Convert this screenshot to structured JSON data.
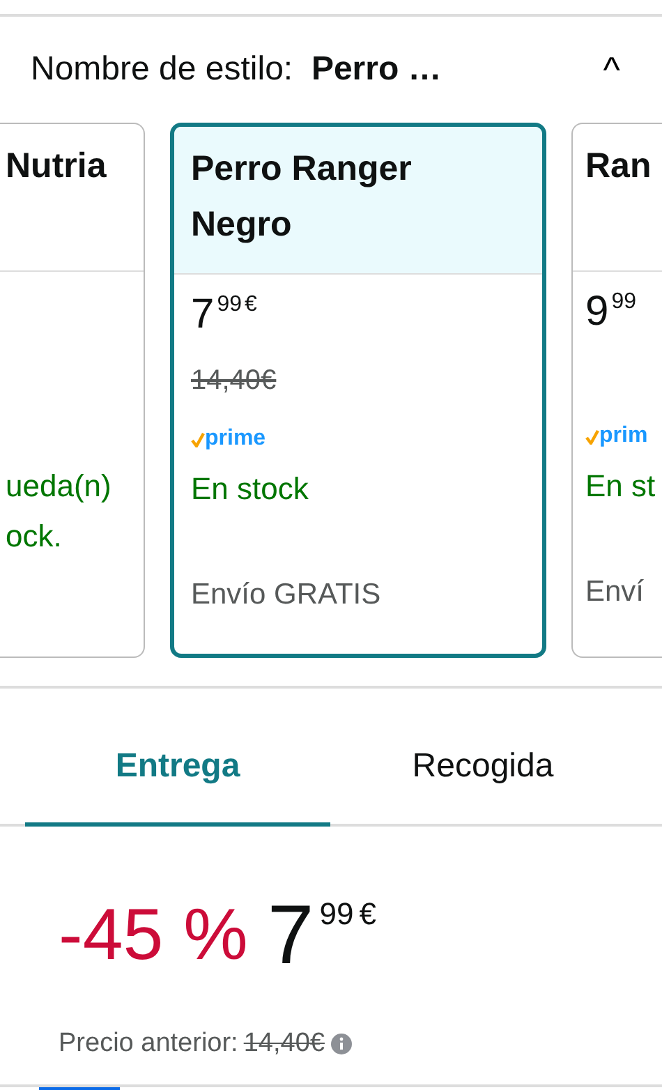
{
  "style_selector": {
    "label": "Nombre de estilo:",
    "value": "Perro …",
    "expanded": true,
    "toggle": "^"
  },
  "options": [
    {
      "name": [
        "Nutria"
      ],
      "selected": false,
      "stock": [
        "ueda(n)",
        "ock."
      ]
    },
    {
      "name": [
        "Perro Ranger",
        "Negro"
      ],
      "selected": true,
      "price": {
        "whole": "7",
        "fraction": "99",
        "currency": "€"
      },
      "old_price": "14,40€",
      "prime": "prime",
      "stock": [
        "En stock"
      ],
      "shipping": "Envío GRATIS"
    },
    {
      "name": [
        "Ran"
      ],
      "selected": false,
      "price": {
        "whole": "9",
        "fraction": "99"
      },
      "prime": "prim",
      "stock": [
        "En st"
      ],
      "shipping": "Enví"
    }
  ],
  "tabs": [
    {
      "label": "Entrega",
      "selected": true
    },
    {
      "label": "Recogida",
      "selected": false
    }
  ],
  "price": {
    "discount": "-45 %",
    "whole": "7",
    "fraction": "99",
    "currency": "€",
    "previous_label": "Precio anterior:",
    "previous_value": "14,40€"
  }
}
